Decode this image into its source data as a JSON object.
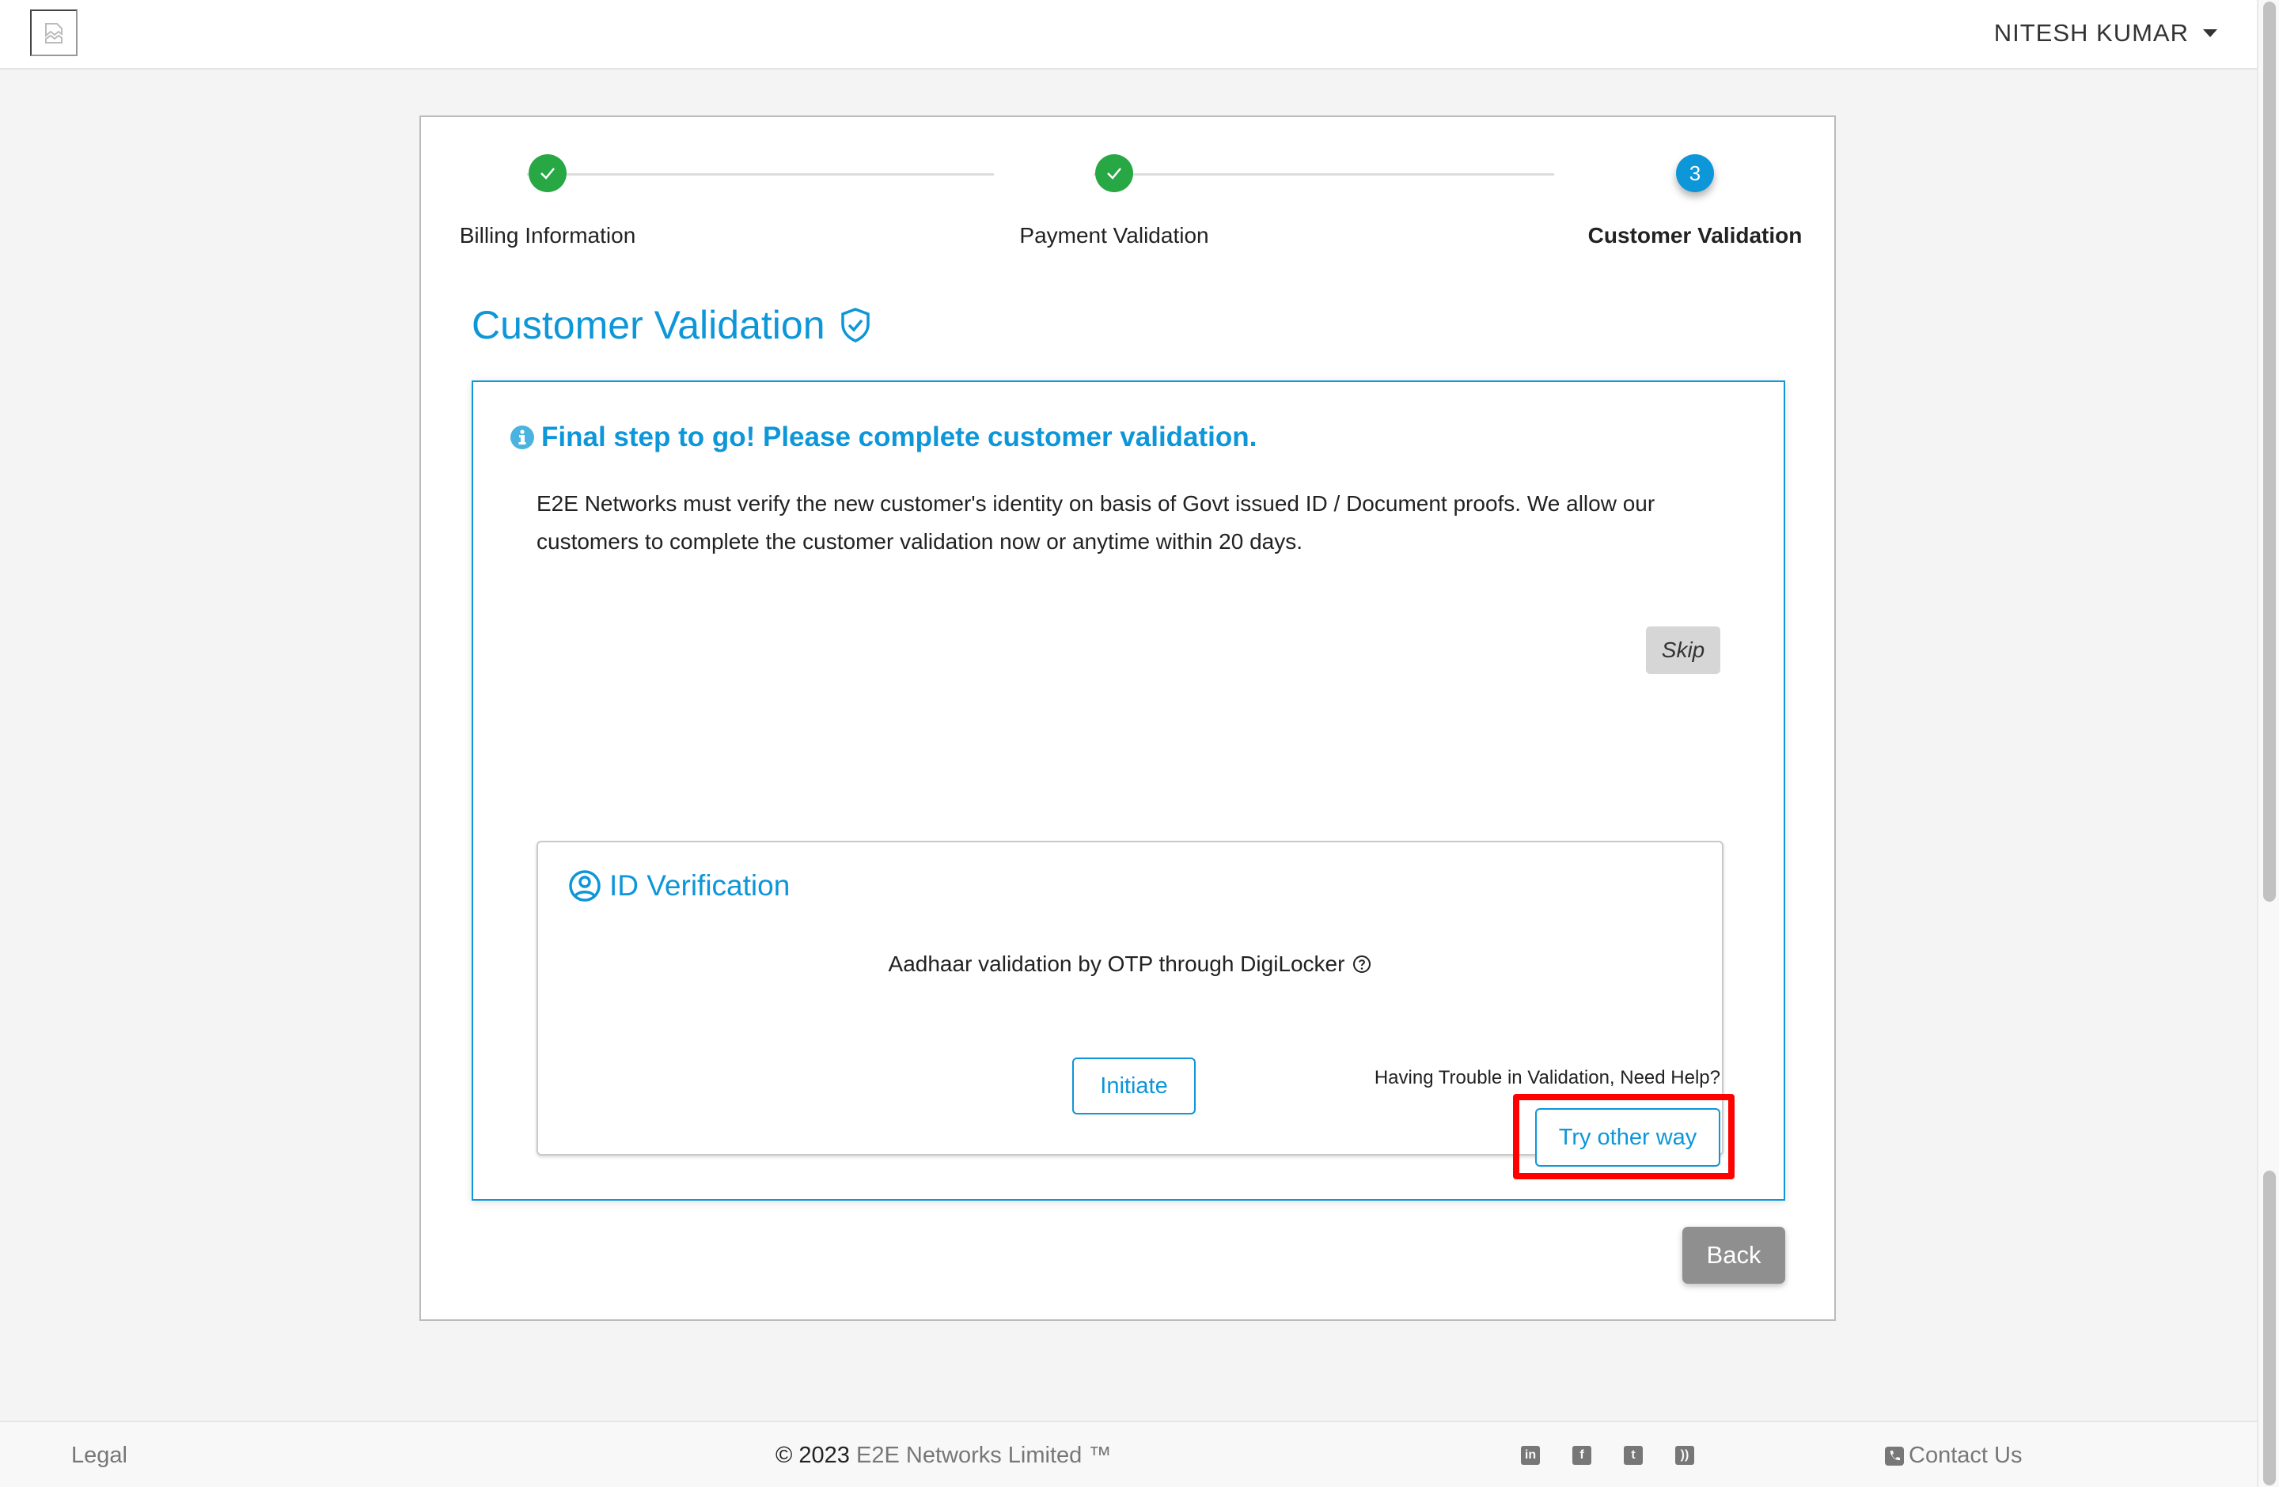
{
  "header": {
    "logo_icon": "broken-image-icon",
    "user_name": "NITESH KUMAR",
    "user_menu_icon": "caret-down-icon"
  },
  "stepper": {
    "steps": [
      {
        "label": "Billing Information",
        "status": "done",
        "marker": "✓"
      },
      {
        "label": "Payment Validation",
        "status": "done",
        "marker": "✓"
      },
      {
        "label": "Customer Validation",
        "status": "active",
        "marker": "3"
      }
    ]
  },
  "page": {
    "title": "Customer Validation",
    "title_icon": "shield-check-icon"
  },
  "notice": {
    "icon": "info-circle-icon",
    "heading": "Final step to go! Please complete customer validation.",
    "description": "E2E Networks must verify the new customer's identity on basis of Govt issued ID / Document proofs. We allow our customers to complete the customer validation now or anytime within 20 days.",
    "skip_label": "Skip"
  },
  "id_verification": {
    "icon": "user-circle-icon",
    "title": "ID Verification",
    "description": "Aadhaar validation by OTP through DigiLocker",
    "help_icon": "question-circle-icon",
    "initiate_label": "Initiate"
  },
  "help": {
    "text": "Having Trouble in Validation, Need Help?",
    "try_other_label": "Try other way"
  },
  "back_label": "Back",
  "footer": {
    "legal": "Legal",
    "copyright_symbol_year": "© 2023",
    "company": "E2E Networks Limited ™",
    "social": [
      {
        "name": "linkedin-icon",
        "glyph": "in"
      },
      {
        "name": "facebook-icon",
        "glyph": "f"
      },
      {
        "name": "twitter-icon",
        "glyph": "t"
      },
      {
        "name": "rss-icon",
        "glyph": "))"
      }
    ],
    "contact_icon": "phone-icon",
    "contact": "Contact Us"
  },
  "colors": {
    "accent": "#0d96d8",
    "success": "#28a745",
    "highlight": "#ff0000",
    "back_button": "#8f8f8f"
  }
}
